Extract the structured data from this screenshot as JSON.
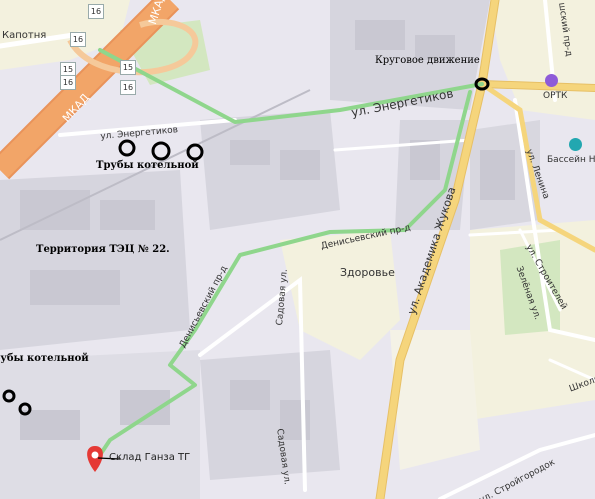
{
  "map": {
    "streets": {
      "kapotnya": "Капотня",
      "mkad_1": "МКАД",
      "mkad_2": "МКАД",
      "energetikov_1": "ул. Энергетиков",
      "energetikov_2": "ул. Энергетиков",
      "denisevsky_1": "Денисьевский пр-д",
      "denisevsky_2": "Денисьевский пр-д",
      "zhukova": "ул. Академика Жукова",
      "sadovaya_1": "Садовая ул.",
      "sadovaya_2": "Садовая ул.",
      "lenina": "ул. Ленина",
      "stroiteley": "ул. Строителей",
      "zelenaya": "Зелёная ул.",
      "shkolnaya": "Школьн",
      "stroitgorodok": "ул. Стройгородок",
      "top_right_street": "шский пр-д"
    },
    "places": {
      "zdorovie": "Здоровье",
      "ortk": "ОРТК",
      "bassein": "Бассейн Не"
    },
    "route_badges": [
      "16",
      "16",
      "15",
      "15",
      "16",
      "16"
    ],
    "annotations": {
      "roundabout": "Круговое движение",
      "pipes_1": "Трубы котельной",
      "tec": "Территория ТЭЦ № 22.",
      "pipes_2": "Трубы котельной"
    },
    "marker": {
      "label": "Склад Ганза ТГ",
      "color": "#e53935"
    },
    "colors": {
      "background": "#e9e7ef",
      "industrial": "#d6d5de",
      "building": "#c9c8d2",
      "residential": "#f3f1de",
      "green": "#d3e7c0",
      "mkad": "#f2a568",
      "arterial": "#f5d57c",
      "route": "#8fd68c",
      "secondary": "#ffffff"
    }
  }
}
